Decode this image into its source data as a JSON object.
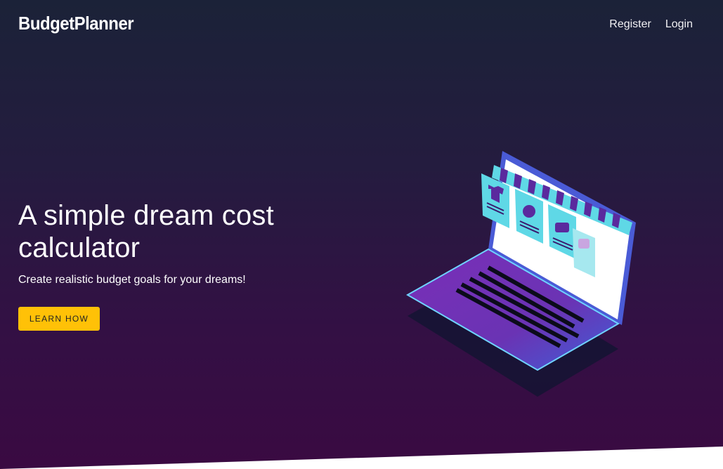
{
  "navbar": {
    "brand": "BudgetPlanner",
    "links": [
      {
        "label": "Register"
      },
      {
        "label": "Login"
      }
    ]
  },
  "hero": {
    "title": "A simple dream cost calculator",
    "subtitle": "Create realistic budget goals for your dreams!",
    "cta_label": "LEARN HOW"
  },
  "colors": {
    "accent": "#ffc107",
    "background_top": "#1b2238",
    "background_bottom": "#3a0a42",
    "laptop_purple": "#6b2fb3",
    "laptop_blue": "#4a5bd6",
    "card_cyan": "#5fd8e6",
    "awning_purple": "#5a2a9e"
  },
  "illustration": {
    "icon": "laptop-shop-illustration",
    "cards": [
      "tshirt-icon",
      "apple-icon",
      "pot-icon",
      "phone-icon"
    ]
  }
}
